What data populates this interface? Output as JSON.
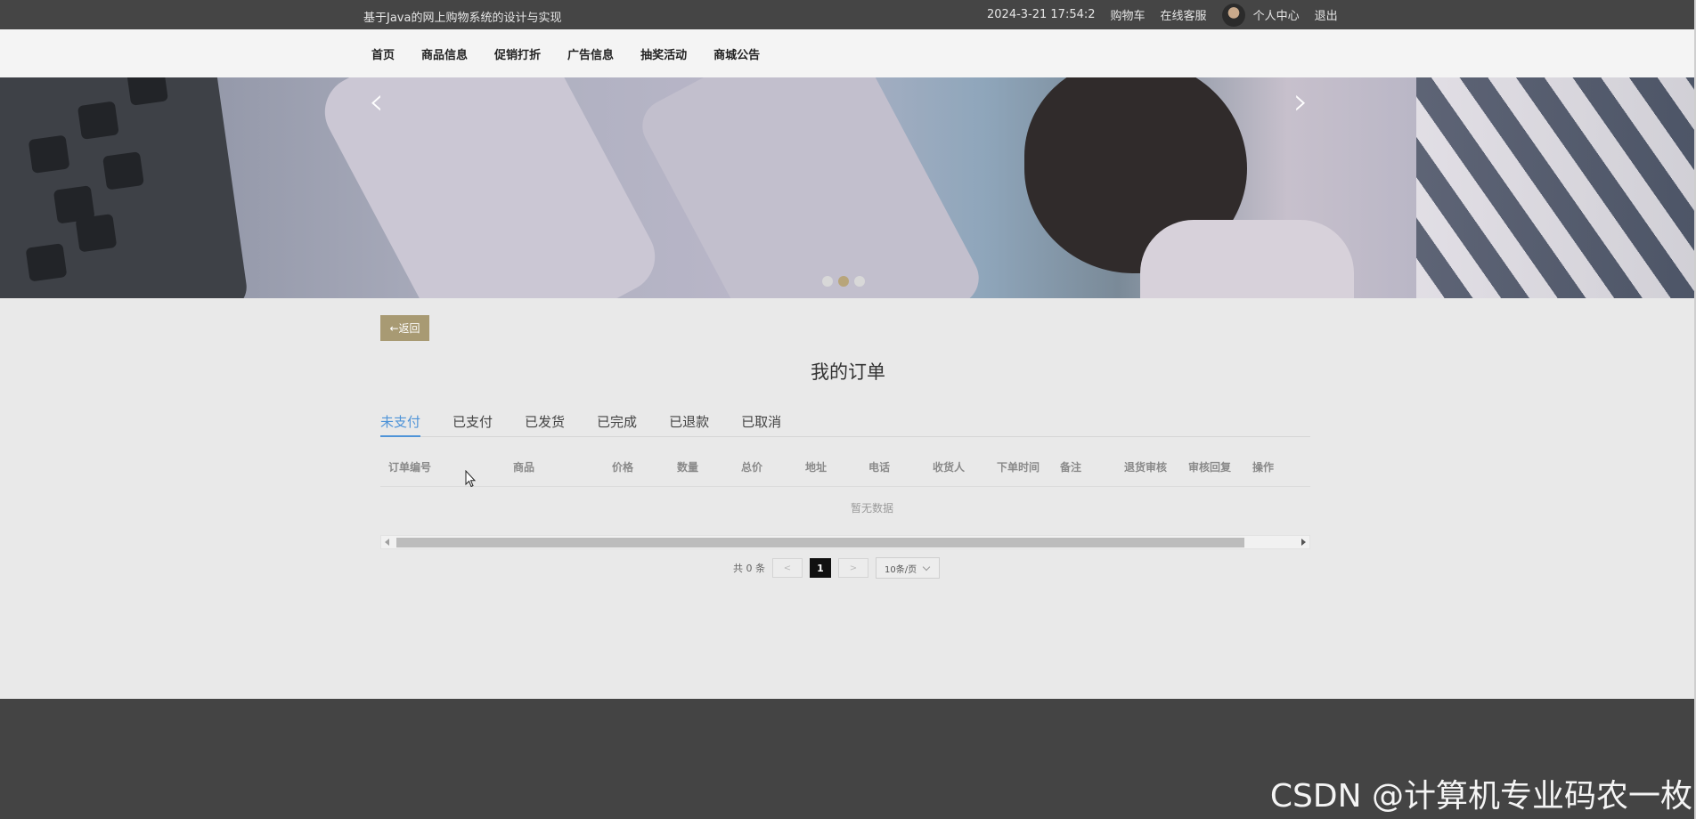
{
  "topbar": {
    "site_title": "基于Java的网上购物系统的设计与实现",
    "datetime": "2024-3-21 17:54:2",
    "cart": "购物车",
    "service": "在线客服",
    "profile": "个人中心",
    "logout": "退出"
  },
  "nav": {
    "items": [
      "首页",
      "商品信息",
      "促销打折",
      "广告信息",
      "抽奖活动",
      "商城公告"
    ]
  },
  "banner": {
    "prev": "‹",
    "next": "›"
  },
  "back_label": "←返回",
  "page_title": "我的订单",
  "tabs": [
    "未支付",
    "已支付",
    "已发货",
    "已完成",
    "已退款",
    "已取消"
  ],
  "table": {
    "columns": [
      "订单编号",
      "商品",
      "价格",
      "数量",
      "总价",
      "地址",
      "电话",
      "收货人",
      "下单时间",
      "备注",
      "退货审核",
      "审核回复",
      "操作"
    ],
    "empty_text": "暂无数据"
  },
  "pager": {
    "total": "共 0 条",
    "prev": "<",
    "page": "1",
    "next": ">",
    "page_size": "10条/页"
  },
  "watermark": "CSDN @计算机专业码农一枚"
}
